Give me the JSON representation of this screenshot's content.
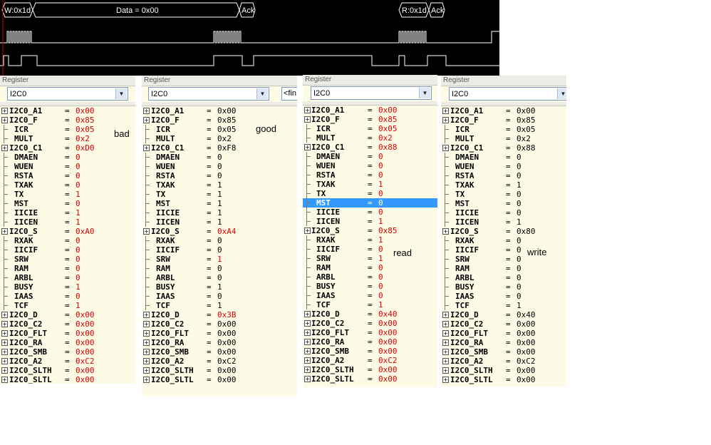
{
  "scope": {
    "protocol_frames": [
      "W:0x1d",
      "Data = 0x00",
      "Ack",
      "R:0x1d",
      "Ack"
    ]
  },
  "panels": [
    {
      "title": "Register",
      "dropdown": "I2C0",
      "annotation": "bad",
      "rows": [
        {
          "type": "group",
          "name": "I2C0_A1",
          "eq": "=",
          "value": "0x00",
          "red": true
        },
        {
          "type": "group",
          "name": "I2C0_F",
          "eq": "=",
          "value": "0x85",
          "red": true
        },
        {
          "type": "field",
          "name": "ICR",
          "eq": "=",
          "value": "0x05",
          "red": true
        },
        {
          "type": "field",
          "name": "MULT",
          "eq": "=",
          "value": "0x2",
          "red": true
        },
        {
          "type": "group",
          "name": "I2C0_C1",
          "eq": "=",
          "value": "0xD0",
          "red": true
        },
        {
          "type": "field",
          "name": "DMAEN",
          "eq": "=",
          "value": "0",
          "red": true
        },
        {
          "type": "field",
          "name": "WUEN",
          "eq": "=",
          "value": "0",
          "red": true
        },
        {
          "type": "field",
          "name": "RSTA",
          "eq": "=",
          "value": "0",
          "red": true
        },
        {
          "type": "field",
          "name": "TXAK",
          "eq": "=",
          "value": "0",
          "red": true
        },
        {
          "type": "field",
          "name": "TX",
          "eq": "=",
          "value": "1",
          "red": true
        },
        {
          "type": "field",
          "name": "MST",
          "eq": "=",
          "value": "0",
          "red": true
        },
        {
          "type": "field",
          "name": "IICIE",
          "eq": "=",
          "value": "1",
          "red": true
        },
        {
          "type": "field",
          "name": "IICEN",
          "eq": "=",
          "value": "1",
          "red": true
        },
        {
          "type": "group",
          "name": "I2C0_S",
          "eq": "=",
          "value": "0xA0",
          "red": true
        },
        {
          "type": "field",
          "name": "RXAK",
          "eq": "=",
          "value": "0",
          "red": true
        },
        {
          "type": "field",
          "name": "IICIF",
          "eq": "=",
          "value": "0",
          "red": true
        },
        {
          "type": "field",
          "name": "SRW",
          "eq": "=",
          "value": "0",
          "red": true
        },
        {
          "type": "field",
          "name": "RAM",
          "eq": "=",
          "value": "0",
          "red": true
        },
        {
          "type": "field",
          "name": "ARBL",
          "eq": "=",
          "value": "0",
          "red": true
        },
        {
          "type": "field",
          "name": "BUSY",
          "eq": "=",
          "value": "1",
          "red": true
        },
        {
          "type": "field",
          "name": "IAAS",
          "eq": "=",
          "value": "0",
          "red": true
        },
        {
          "type": "field",
          "name": "TCF",
          "eq": "=",
          "value": "1",
          "red": true
        },
        {
          "type": "group",
          "name": "I2C0_D",
          "eq": "=",
          "value": "0x00",
          "red": true
        },
        {
          "type": "group",
          "name": "I2C0_C2",
          "eq": "=",
          "value": "0x00",
          "red": true
        },
        {
          "type": "group",
          "name": "I2C0_FLT",
          "eq": "=",
          "value": "0x00",
          "red": true
        },
        {
          "type": "group",
          "name": "I2C0_RA",
          "eq": "=",
          "value": "0x00",
          "red": true
        },
        {
          "type": "group",
          "name": "I2C0_SMB",
          "eq": "=",
          "value": "0x00",
          "red": true
        },
        {
          "type": "group",
          "name": "I2C0_A2",
          "eq": "=",
          "value": "0xC2",
          "red": true
        },
        {
          "type": "group",
          "name": "I2C0_SLTH",
          "eq": "=",
          "value": "0x00",
          "red": true
        },
        {
          "type": "group",
          "name": "I2C0_SLTL",
          "eq": "=",
          "value": "0x00",
          "red": true
        }
      ]
    },
    {
      "title": "Register",
      "dropdown": "I2C0",
      "annotation": "good",
      "extra_field": "<fin",
      "rows": [
        {
          "type": "group",
          "name": "I2C0_A1",
          "eq": "=",
          "value": "0x00",
          "red": false
        },
        {
          "type": "group",
          "name": "I2C0_F",
          "eq": "=",
          "value": "0x85",
          "red": false
        },
        {
          "type": "field",
          "name": "ICR",
          "eq": "=",
          "value": "0x05",
          "red": false
        },
        {
          "type": "field",
          "name": "MULT",
          "eq": "=",
          "value": "0x2",
          "red": false
        },
        {
          "type": "group",
          "name": "I2C0_C1",
          "eq": "=",
          "value": "0xF8",
          "red": false
        },
        {
          "type": "field",
          "name": "DMAEN",
          "eq": "=",
          "value": "0",
          "red": false
        },
        {
          "type": "field",
          "name": "WUEN",
          "eq": "=",
          "value": "0",
          "red": false
        },
        {
          "type": "field",
          "name": "RSTA",
          "eq": "=",
          "value": "0",
          "red": false
        },
        {
          "type": "field",
          "name": "TXAK",
          "eq": "=",
          "value": "1",
          "red": false
        },
        {
          "type": "field",
          "name": "TX",
          "eq": "=",
          "value": "1",
          "red": false
        },
        {
          "type": "field",
          "name": "MST",
          "eq": "=",
          "value": "1",
          "red": false
        },
        {
          "type": "field",
          "name": "IICIE",
          "eq": "=",
          "value": "1",
          "red": false
        },
        {
          "type": "field",
          "name": "IICEN",
          "eq": "=",
          "value": "1",
          "red": false
        },
        {
          "type": "group",
          "name": "I2C0_S",
          "eq": "=",
          "value": "0xA4",
          "red": true
        },
        {
          "type": "field",
          "name": "RXAK",
          "eq": "=",
          "value": "0",
          "red": false
        },
        {
          "type": "field",
          "name": "IICIF",
          "eq": "=",
          "value": "0",
          "red": false
        },
        {
          "type": "field",
          "name": "SRW",
          "eq": "=",
          "value": "1",
          "red": true
        },
        {
          "type": "field",
          "name": "RAM",
          "eq": "=",
          "value": "0",
          "red": false
        },
        {
          "type": "field",
          "name": "ARBL",
          "eq": "=",
          "value": "0",
          "red": false
        },
        {
          "type": "field",
          "name": "BUSY",
          "eq": "=",
          "value": "1",
          "red": false
        },
        {
          "type": "field",
          "name": "IAAS",
          "eq": "=",
          "value": "0",
          "red": false
        },
        {
          "type": "field",
          "name": "TCF",
          "eq": "=",
          "value": "1",
          "red": false
        },
        {
          "type": "group",
          "name": "I2C0_D",
          "eq": "=",
          "value": "0x3B",
          "red": true
        },
        {
          "type": "group",
          "name": "I2C0_C2",
          "eq": "=",
          "value": "0x00",
          "red": false
        },
        {
          "type": "group",
          "name": "I2C0_FLT",
          "eq": "=",
          "value": "0x00",
          "red": false
        },
        {
          "type": "group",
          "name": "I2C0_RA",
          "eq": "=",
          "value": "0x00",
          "red": false
        },
        {
          "type": "group",
          "name": "I2C0_SMB",
          "eq": "=",
          "value": "0x00",
          "red": false
        },
        {
          "type": "group",
          "name": "I2C0_A2",
          "eq": "=",
          "value": "0xC2",
          "red": false
        },
        {
          "type": "group",
          "name": "I2C0_SLTH",
          "eq": "=",
          "value": "0x00",
          "red": false
        },
        {
          "type": "group",
          "name": "I2C0_SLTL",
          "eq": "=",
          "value": "0x00",
          "red": false
        }
      ]
    },
    {
      "title": "Register",
      "dropdown": "I2C0",
      "annotation": "read",
      "rows": [
        {
          "type": "group",
          "name": "I2C0_A1",
          "eq": "=",
          "value": "0x00",
          "red": true
        },
        {
          "type": "group",
          "name": "I2C0_F",
          "eq": "=",
          "value": "0x85",
          "red": true
        },
        {
          "type": "field",
          "name": "ICR",
          "eq": "=",
          "value": "0x05",
          "red": true
        },
        {
          "type": "field",
          "name": "MULT",
          "eq": "=",
          "value": "0x2",
          "red": true
        },
        {
          "type": "group",
          "name": "I2C0_C1",
          "eq": "=",
          "value": "0x88",
          "red": true
        },
        {
          "type": "field",
          "name": "DMAEN",
          "eq": "=",
          "value": "0",
          "red": true
        },
        {
          "type": "field",
          "name": "WUEN",
          "eq": "=",
          "value": "0",
          "red": true
        },
        {
          "type": "field",
          "name": "RSTA",
          "eq": "=",
          "value": "0",
          "red": true
        },
        {
          "type": "field",
          "name": "TXAK",
          "eq": "=",
          "value": "1",
          "red": true
        },
        {
          "type": "field",
          "name": "TX",
          "eq": "=",
          "value": "0",
          "red": true
        },
        {
          "type": "field",
          "name": "MST",
          "eq": "=",
          "value": "0",
          "red": true,
          "selected": true
        },
        {
          "type": "field",
          "name": "IICIE",
          "eq": "=",
          "value": "0",
          "red": true
        },
        {
          "type": "field",
          "name": "IICEN",
          "eq": "=",
          "value": "1",
          "red": true
        },
        {
          "type": "group",
          "name": "I2C0_S",
          "eq": "=",
          "value": "0x85",
          "red": true
        },
        {
          "type": "field",
          "name": "RXAK",
          "eq": "=",
          "value": "1",
          "red": true
        },
        {
          "type": "field",
          "name": "IICIF",
          "eq": "=",
          "value": "0",
          "red": true
        },
        {
          "type": "field",
          "name": "SRW",
          "eq": "=",
          "value": "1",
          "red": true
        },
        {
          "type": "field",
          "name": "RAM",
          "eq": "=",
          "value": "0",
          "red": true
        },
        {
          "type": "field",
          "name": "ARBL",
          "eq": "=",
          "value": "0",
          "red": true
        },
        {
          "type": "field",
          "name": "BUSY",
          "eq": "=",
          "value": "0",
          "red": true
        },
        {
          "type": "field",
          "name": "IAAS",
          "eq": "=",
          "value": "0",
          "red": true
        },
        {
          "type": "field",
          "name": "TCF",
          "eq": "=",
          "value": "1",
          "red": true
        },
        {
          "type": "group",
          "name": "I2C0_D",
          "eq": "=",
          "value": "0x40",
          "red": true
        },
        {
          "type": "group",
          "name": "I2C0_C2",
          "eq": "=",
          "value": "0x00",
          "red": true
        },
        {
          "type": "group",
          "name": "I2C0_FLT",
          "eq": "=",
          "value": "0x00",
          "red": true
        },
        {
          "type": "group",
          "name": "I2C0_RA",
          "eq": "=",
          "value": "0x00",
          "red": true
        },
        {
          "type": "group",
          "name": "I2C0_SMB",
          "eq": "=",
          "value": "0x00",
          "red": true
        },
        {
          "type": "group",
          "name": "I2C0_A2",
          "eq": "=",
          "value": "0xC2",
          "red": true
        },
        {
          "type": "group",
          "name": "I2C0_SLTH",
          "eq": "=",
          "value": "0x00",
          "red": true
        },
        {
          "type": "group",
          "name": "I2C0_SLTL",
          "eq": "=",
          "value": "0x00",
          "red": true
        }
      ]
    },
    {
      "title": "Register",
      "dropdown": "I2C0",
      "annotation": "write",
      "rows": [
        {
          "type": "group",
          "name": "I2C0_A1",
          "eq": "=",
          "value": "0x00",
          "red": false
        },
        {
          "type": "group",
          "name": "I2C0_F",
          "eq": "=",
          "value": "0x85",
          "red": false
        },
        {
          "type": "field",
          "name": "ICR",
          "eq": "=",
          "value": "0x05",
          "red": false
        },
        {
          "type": "field",
          "name": "MULT",
          "eq": "=",
          "value": "0x2",
          "red": false
        },
        {
          "type": "group",
          "name": "I2C0_C1",
          "eq": "=",
          "value": "0x88",
          "red": false
        },
        {
          "type": "field",
          "name": "DMAEN",
          "eq": "=",
          "value": "0",
          "red": false
        },
        {
          "type": "field",
          "name": "WUEN",
          "eq": "=",
          "value": "0",
          "red": false
        },
        {
          "type": "field",
          "name": "RSTA",
          "eq": "=",
          "value": "0",
          "red": false
        },
        {
          "type": "field",
          "name": "TXAK",
          "eq": "=",
          "value": "1",
          "red": false
        },
        {
          "type": "field",
          "name": "TX",
          "eq": "=",
          "value": "0",
          "red": false
        },
        {
          "type": "field",
          "name": "MST",
          "eq": "=",
          "value": "0",
          "red": false
        },
        {
          "type": "field",
          "name": "IICIE",
          "eq": "=",
          "value": "0",
          "red": false
        },
        {
          "type": "field",
          "name": "IICEN",
          "eq": "=",
          "value": "1",
          "red": false
        },
        {
          "type": "group",
          "name": "I2C0_S",
          "eq": "=",
          "value": "0x80",
          "red": false
        },
        {
          "type": "field",
          "name": "RXAK",
          "eq": "=",
          "value": "0",
          "red": false
        },
        {
          "type": "field",
          "name": "IICIF",
          "eq": "=",
          "value": "0",
          "red": false
        },
        {
          "type": "field",
          "name": "SRW",
          "eq": "=",
          "value": "0",
          "red": false
        },
        {
          "type": "field",
          "name": "RAM",
          "eq": "=",
          "value": "0",
          "red": false
        },
        {
          "type": "field",
          "name": "ARBL",
          "eq": "=",
          "value": "0",
          "red": false
        },
        {
          "type": "field",
          "name": "BUSY",
          "eq": "=",
          "value": "0",
          "red": false
        },
        {
          "type": "field",
          "name": "IAAS",
          "eq": "=",
          "value": "0",
          "red": false
        },
        {
          "type": "field",
          "name": "TCF",
          "eq": "=",
          "value": "1",
          "red": false
        },
        {
          "type": "group",
          "name": "I2C0_D",
          "eq": "=",
          "value": "0x40",
          "red": false
        },
        {
          "type": "group",
          "name": "I2C0_C2",
          "eq": "=",
          "value": "0x00",
          "red": false
        },
        {
          "type": "group",
          "name": "I2C0_FLT",
          "eq": "=",
          "value": "0x00",
          "red": false
        },
        {
          "type": "group",
          "name": "I2C0_RA",
          "eq": "=",
          "value": "0x00",
          "red": false
        },
        {
          "type": "group",
          "name": "I2C0_SMB",
          "eq": "=",
          "value": "0x00",
          "red": false
        },
        {
          "type": "group",
          "name": "I2C0_A2",
          "eq": "=",
          "value": "0xC2",
          "red": false
        },
        {
          "type": "group",
          "name": "I2C0_SLTH",
          "eq": "=",
          "value": "0x00",
          "red": false
        },
        {
          "type": "group",
          "name": "I2C0_SLTL",
          "eq": "=",
          "value": "0x00",
          "red": false
        }
      ]
    }
  ]
}
